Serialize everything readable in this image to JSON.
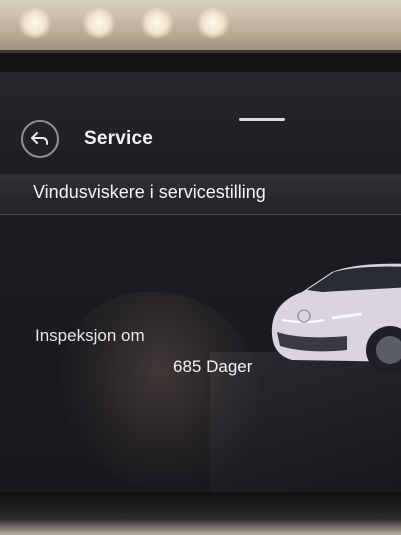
{
  "header": {
    "title": "Service",
    "back_icon": "back-arrow-icon"
  },
  "settings": {
    "wiper_service_label": "Vindusviskere i servicestilling"
  },
  "inspection": {
    "label": "Inspeksjon om",
    "value": "685 Dager"
  },
  "colors": {
    "screen_background": "#1c1d22",
    "text_primary": "#f2f2f4",
    "back_button_ring": "#8e9098"
  }
}
